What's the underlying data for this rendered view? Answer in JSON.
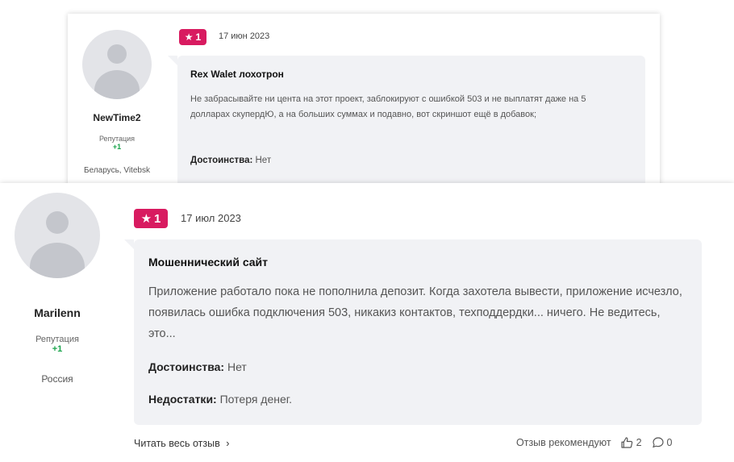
{
  "reviews": [
    {
      "user": {
        "name": "NewTime2",
        "reputation_label": "Репутация",
        "reputation_value": "+1",
        "location": "Беларусь, Vitebsk"
      },
      "rating": "1",
      "date": "17 июн 2023",
      "title": "Rex Walet лохотрон",
      "text": "Не забрасывайте ни цента на этот проект, заблокируют с ошибкой 503 и не выплатят даже на 5 долларах скупердЮ, а на больших суммах и подавно, вот скриншот ещё в добавок;",
      "pros_label": "Достоинства:",
      "pros_value": "Нет"
    },
    {
      "user": {
        "name": "Marilenn",
        "reputation_label": "Репутация",
        "reputation_value": "+1",
        "location": "Россия"
      },
      "rating": "1",
      "date": "17 июл 2023",
      "title": "Мошеннический сайт",
      "text": "Приложение работало пока не пополнила депозит. Когда захотела вывести, приложение исчезло, появилась ошибка подключения 503, никакиз контактов, техподдердки... ничего. Не ведитесь, это...",
      "pros_label": "Достоинства:",
      "pros_value": "Нет",
      "cons_label": "Недостатки:",
      "cons_value": "Потеря денег.",
      "read_more": "Читать весь отзыв",
      "recommend_label": "Отзыв рекомендуют",
      "likes": "2",
      "comments": "0"
    }
  ],
  "colors": {
    "badge": "#d81b60",
    "reputation": "#17a34a",
    "bubble": "#f1f2f5"
  },
  "icons": [
    "star-icon",
    "avatar-placeholder-icon",
    "thumbs-up-icon",
    "comment-icon",
    "chevron-right-icon"
  ]
}
